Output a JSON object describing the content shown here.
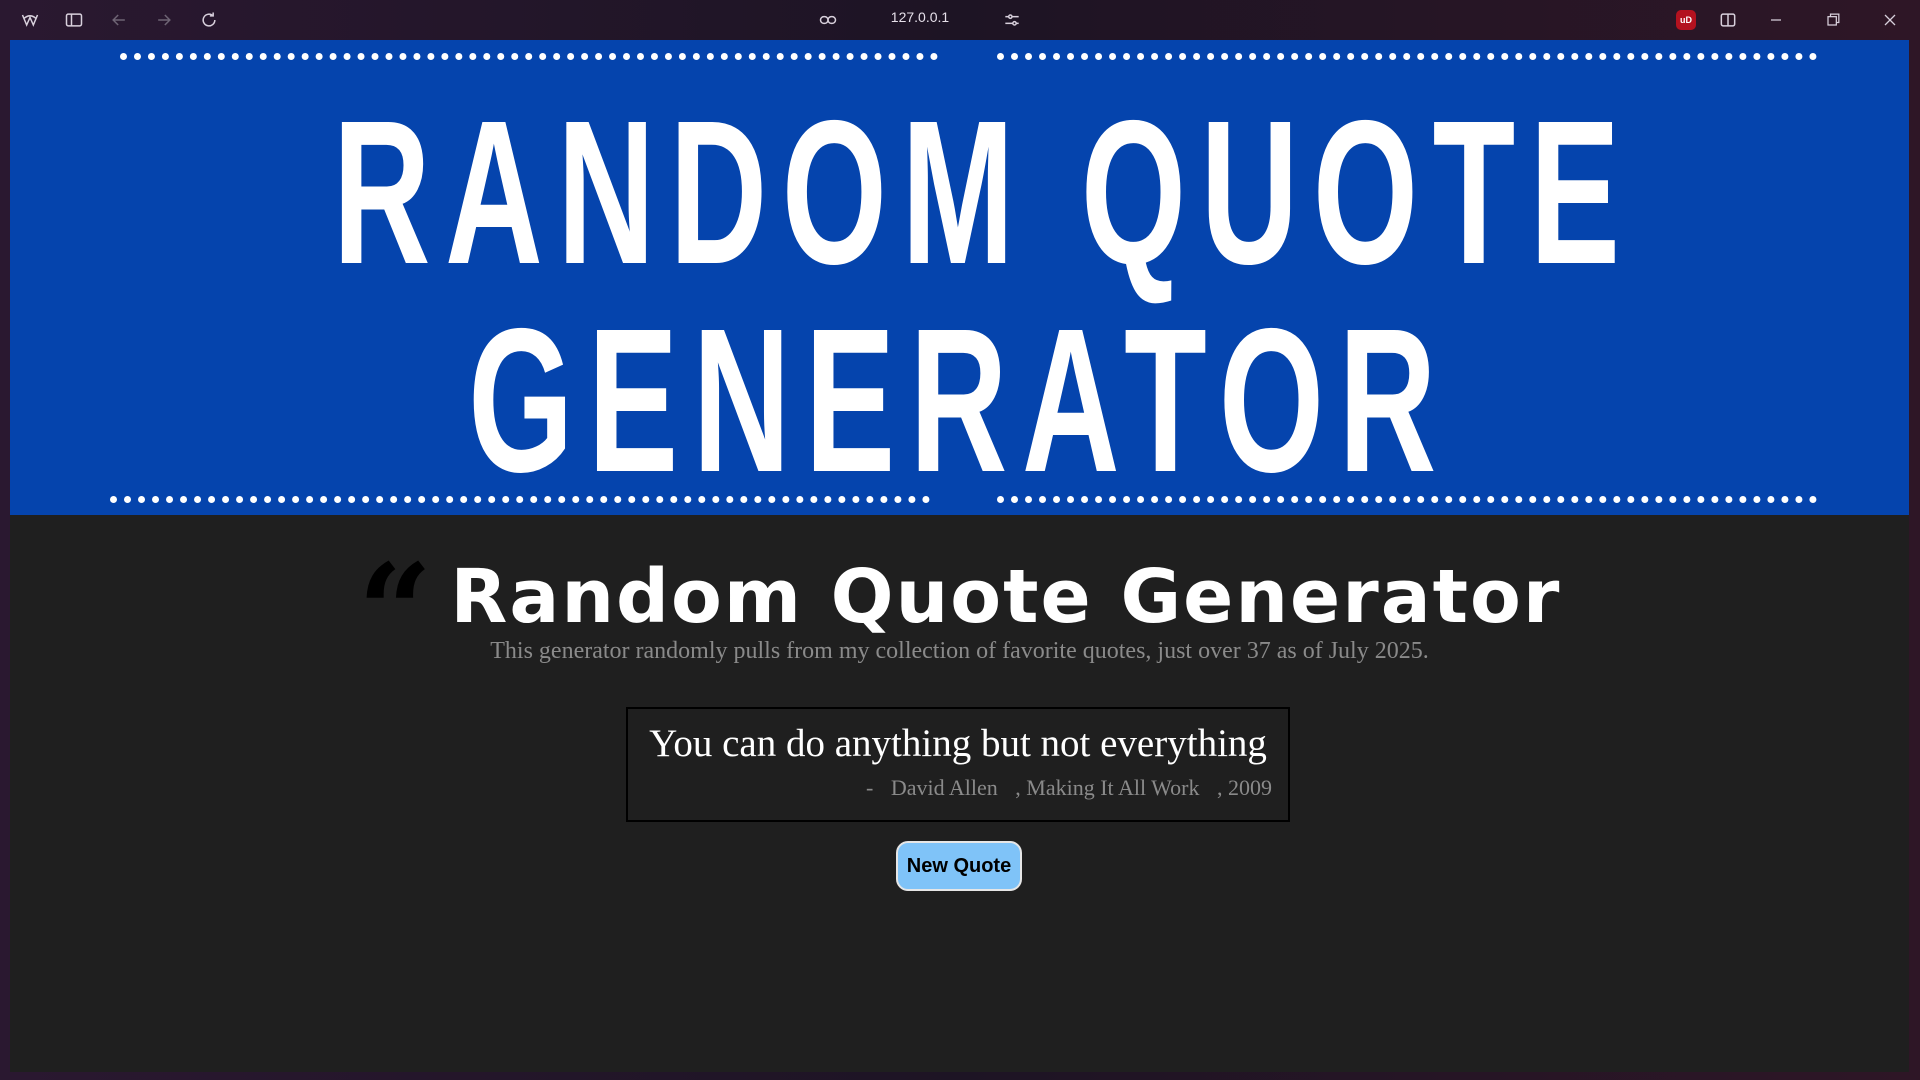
{
  "browser": {
    "url": "127.0.0.1",
    "ublock_badge": "uD"
  },
  "banner": {
    "line1": "RANDOM QUOTE",
    "line2": "GENERATOR"
  },
  "page": {
    "title": "Random Quote Generator",
    "subtitle": "This generator randomly pulls from my collection of favorite quotes, just over 37 as of July 2025."
  },
  "quote": {
    "text": "You can do anything but not everything",
    "dash": "-",
    "author": "David Allen",
    "source": ", Making It All Work",
    "year": ", 2009"
  },
  "button": {
    "new_quote": "New Quote"
  },
  "colors": {
    "banner_bg": "#0544ad",
    "page_bg": "#1f1f1f",
    "button_bg": "#7fc3f8"
  }
}
